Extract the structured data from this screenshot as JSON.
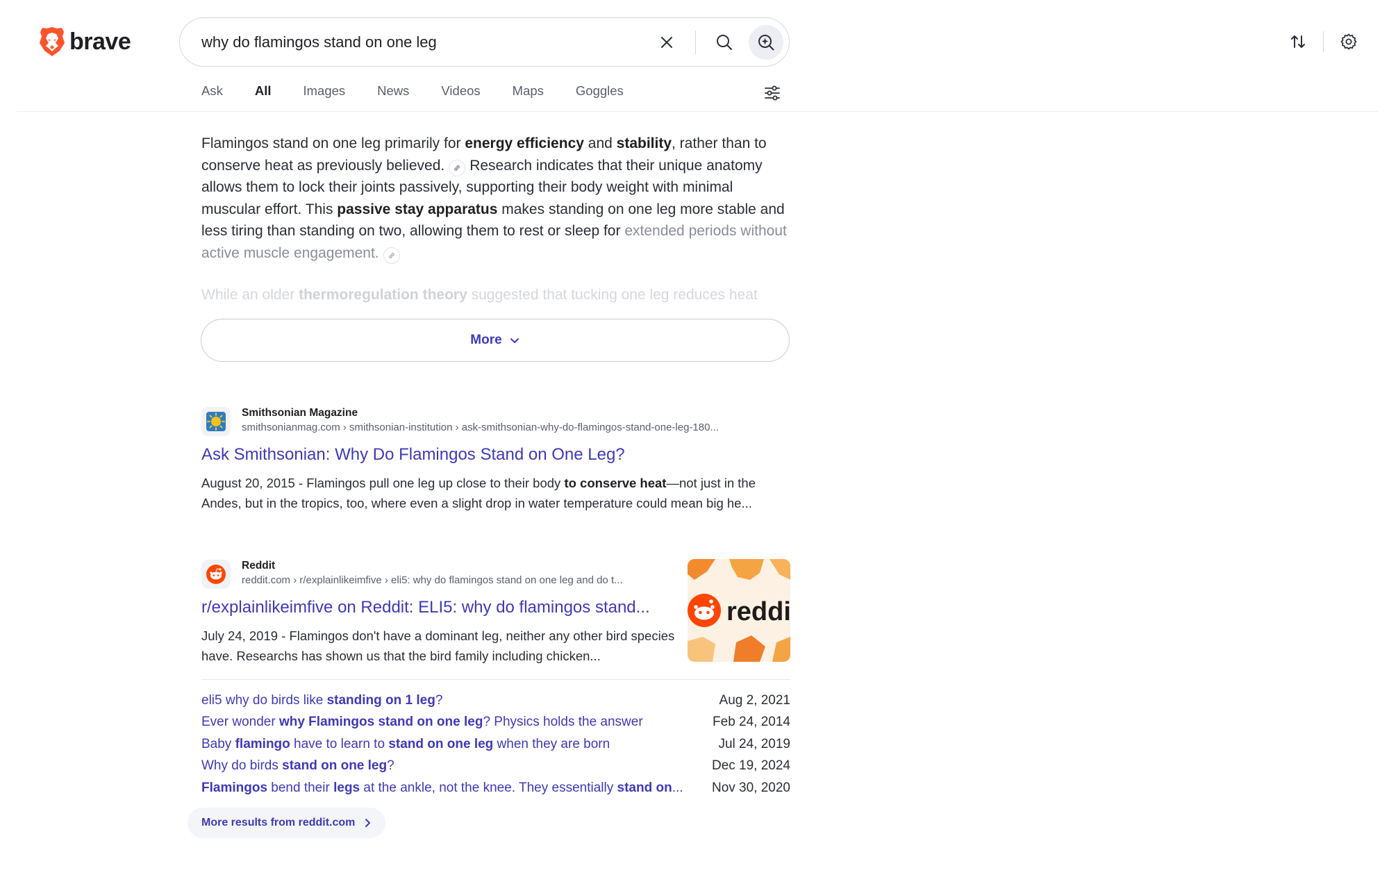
{
  "brand": {
    "name": "brave",
    "accent": "#fb542b"
  },
  "search": {
    "query": "why do flamingos stand on one leg"
  },
  "tabs": [
    {
      "label": "Ask"
    },
    {
      "label": "All"
    },
    {
      "label": "Images"
    },
    {
      "label": "News"
    },
    {
      "label": "Videos"
    },
    {
      "label": "Maps"
    },
    {
      "label": "Goggles"
    }
  ],
  "answer": {
    "p1_a": "Flamingos stand on one leg primarily for ",
    "p1_b1": "energy efficiency",
    "p1_c": " and ",
    "p1_b2": "stability",
    "p1_d": ", rather than to conserve heat as previously believed.",
    "p1_e": "Research indicates that their unique anatomy allows them to lock their joints passively, supporting their body weight with minimal muscular effort. This ",
    "p1_b3": "passive stay apparatus",
    "p1_f": " makes standing on one leg more stable and less tiring than standing on two, allowing them to rest or sleep for ",
    "p1_g": "extended periods without active muscle engagement.",
    "p2_a": "While an older ",
    "p2_b": "thermoregulation theory",
    "p2_c": " suggested that tucking one leg reduces heat",
    "more_label": "More"
  },
  "results": [
    {
      "site": "Smithsonian Magazine",
      "url": "smithsonianmag.com › smithsonian-institution › ask-smithsonian-why-do-flamingos-stand-one-leg-180...",
      "title": "Ask Smithsonian: Why Do Flamingos Stand on One Leg?",
      "date": "August 20, 2015",
      "desc_a": " - Flamingos pull one leg up close to their body ",
      "desc_b": "to conserve heat",
      "desc_c": "—not just in the Andes, but in the tropics, too, where even a slight drop in water temperature could mean big he..."
    },
    {
      "site": "Reddit",
      "url": "reddit.com › r/explainlikeimfive › eli5: why do flamingos stand on one leg and do t...",
      "title": "r/explainlikeimfive on Reddit: ELI5: why do flamingos stand...",
      "date": "July 24, 2019",
      "desc": " - Flamingos don't have a dominant leg, neither any other bird species have. Researchs has shown us that the bird family including chicken...",
      "thumb_text": "reddit"
    }
  ],
  "sublinks": [
    {
      "t1": "eli5 why do birds like ",
      "b1": "standing on 1 leg",
      "t2": "?",
      "date": "Aug 2, 2021"
    },
    {
      "t1": "Ever wonder ",
      "b1": "why Flamingos stand on one leg",
      "t2": "? Physics holds the answer",
      "date": "Feb 24, 2014"
    },
    {
      "t1": "Baby ",
      "b1": "flamingo",
      "t2": " have to learn to ",
      "b2": "stand on one leg",
      "t3": " when they are born",
      "date": "Jul 24, 2019"
    },
    {
      "t1": "Why do birds ",
      "b1": "stand on one leg",
      "t2": "?",
      "date": "Dec 19, 2024"
    },
    {
      "b0": "Flamingos",
      "t1": " bend their ",
      "b1": "legs",
      "t2": " at the ankle, not the knee. They essentially ",
      "b2": "stand on",
      "t3": "...",
      "date": "Nov 30, 2020"
    }
  ],
  "more_results_label": "More results from reddit.com"
}
